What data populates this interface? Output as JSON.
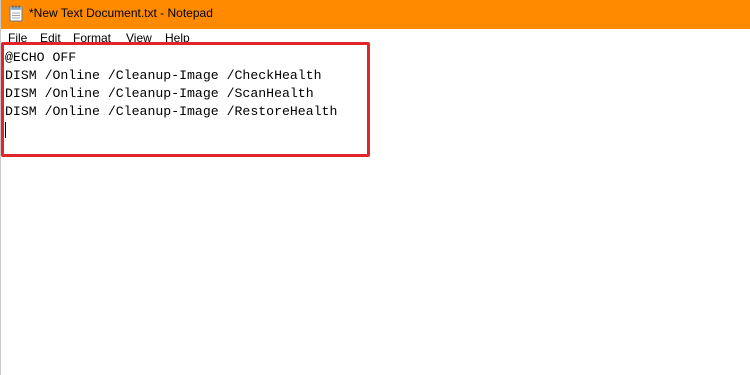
{
  "window": {
    "title": "*New Text Document.txt - Notepad",
    "app_icon": "notepad-icon",
    "titlebar_color": "#ff8a00"
  },
  "menu": {
    "items": [
      {
        "label": "File"
      },
      {
        "label": "Edit"
      },
      {
        "label": "Format"
      },
      {
        "label": "View"
      },
      {
        "label": "Help"
      }
    ]
  },
  "editor": {
    "lines": [
      "@ECHO OFF",
      "DISM /Online /Cleanup-Image /CheckHealth",
      "DISM /Online /Cleanup-Image /ScanHealth",
      "DISM /Online /Cleanup-Image /RestoreHealth"
    ]
  },
  "annotation": {
    "highlight_color": "#e0262a"
  }
}
